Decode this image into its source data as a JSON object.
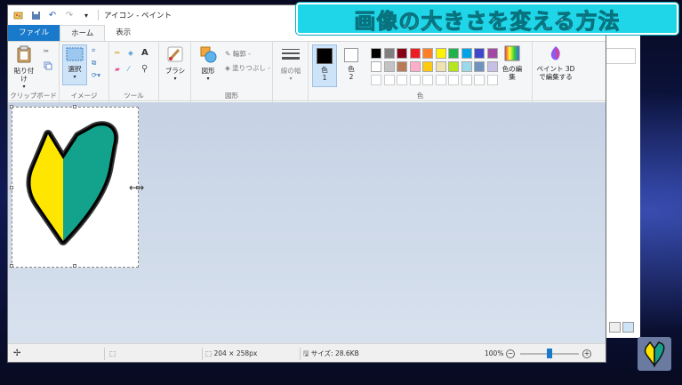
{
  "banner": {
    "text": "画像の大きさを変える方法"
  },
  "window": {
    "title": "アイコン - ペイント",
    "qa_icons": [
      "paint-app-icon",
      "save-icon",
      "undo-icon",
      "redo-icon",
      "customize-icon"
    ]
  },
  "tabs": {
    "file": "ファイル",
    "home": "ホーム",
    "view": "表示"
  },
  "ribbon": {
    "clipboard": {
      "paste": "貼り付け",
      "label": "クリップボード"
    },
    "image": {
      "select": "選択",
      "label": "イメージ"
    },
    "tools": {
      "label": "ツール"
    },
    "brush": {
      "label": "ブラシ"
    },
    "shapes": {
      "shapes": "図形",
      "outline": "輪郭 -",
      "fill": "塗りつぶし -",
      "label": "図形"
    },
    "size": {
      "label": "線の幅"
    },
    "colors": {
      "color1": "色",
      "color1_num": "1",
      "color2": "色",
      "color2_num": "2",
      "edit": "色の編集",
      "label": "色",
      "color1_value": "#000000",
      "color2_value": "#ffffff",
      "palette_row1": [
        "#000000",
        "#7f7f7f",
        "#880015",
        "#ed1c24",
        "#ff7f27",
        "#fff200",
        "#22b14c",
        "#00a2e8",
        "#3f48cc",
        "#a349a4"
      ],
      "palette_row2": [
        "#ffffff",
        "#c3c3c3",
        "#b97a57",
        "#ffaec9",
        "#ffc90e",
        "#efe4b0",
        "#b5e61d",
        "#99d9ea",
        "#7092be",
        "#c8bfe7"
      ]
    },
    "paint3d": {
      "label": "ペイント 3D で編集する"
    }
  },
  "status": {
    "dimensions": "204 × 258px",
    "size": "サイズ: 28.6KB",
    "zoom": "100%",
    "zoom_level": 0.5
  },
  "colors": {
    "wakaba_yellow": "#ffe600",
    "wakaba_green": "#13a38c",
    "banner": "#1fd6e8",
    "file_tab": "#1979ca"
  }
}
